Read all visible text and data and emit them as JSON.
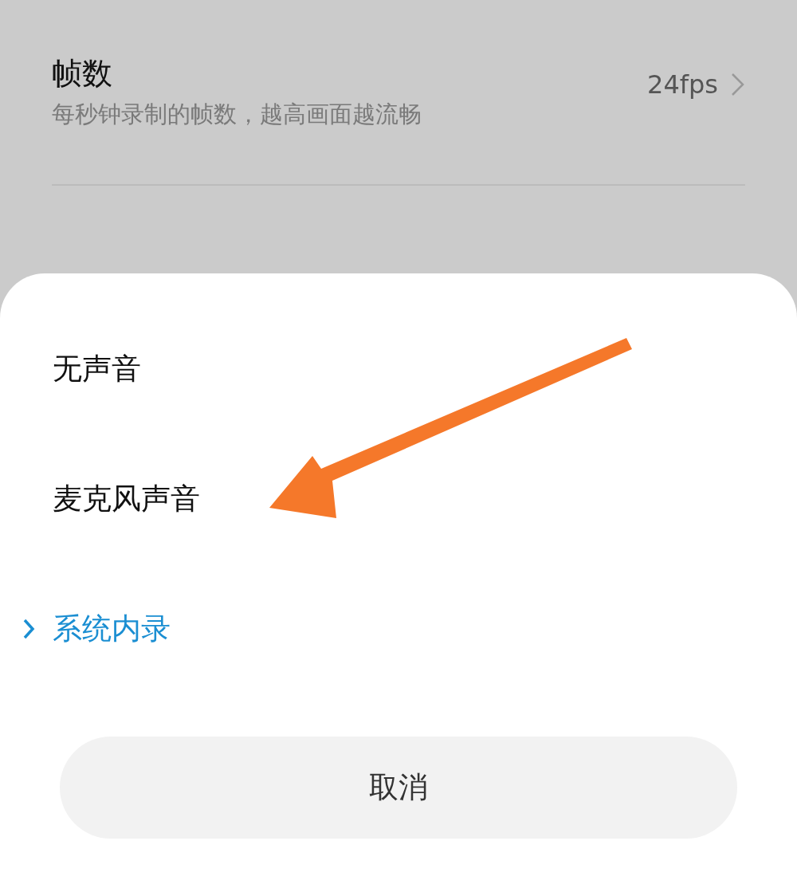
{
  "setting": {
    "title": "帧数",
    "description": "每秒钟录制的帧数，越高画面越流畅",
    "value": "24fps"
  },
  "sound_options": [
    {
      "label": "无声音",
      "selected": false
    },
    {
      "label": "麦克风声音",
      "selected": false
    },
    {
      "label": "系统内录",
      "selected": true
    }
  ],
  "cancel_button": "取消"
}
